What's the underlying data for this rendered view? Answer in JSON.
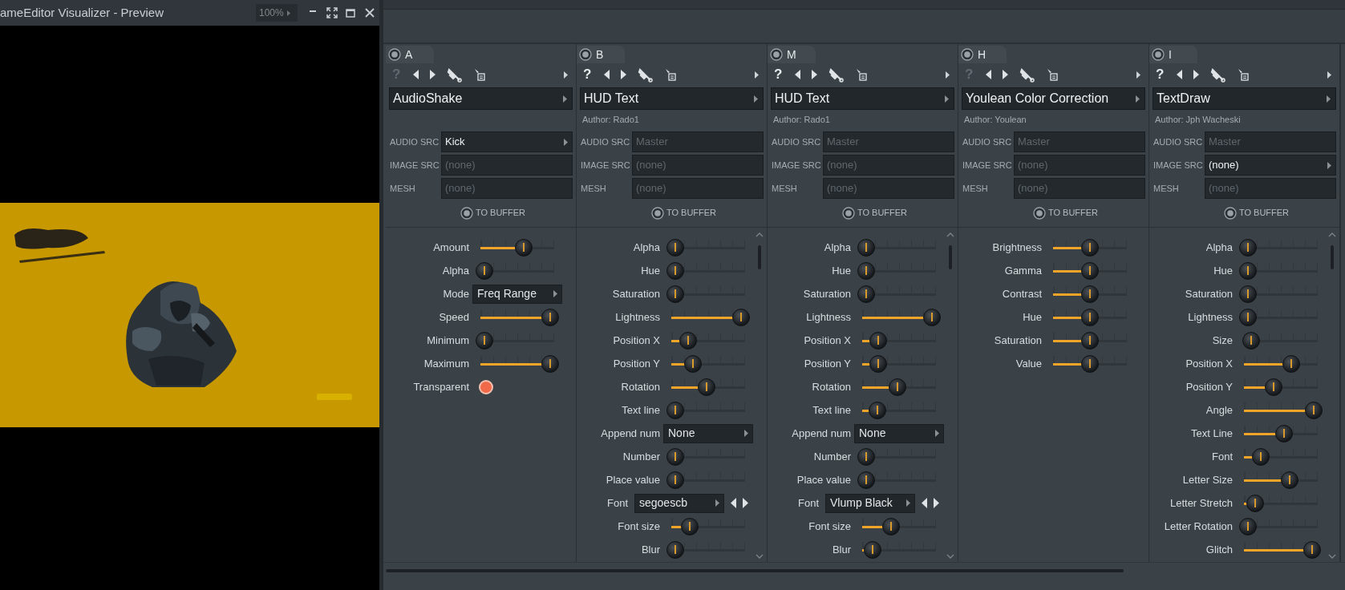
{
  "preview_window": {
    "title": "ameEditor Visualizer - Preview",
    "zoom": "100%"
  },
  "columns": [
    {
      "tab": "A",
      "help": "?",
      "help_enabled": false,
      "plugin": "AudioShake",
      "sources": [
        {
          "label": "AUDIO SRC",
          "value": "Kick",
          "enabled": true
        },
        {
          "label": "IMAGE SRC",
          "value": "(none)",
          "enabled": false
        },
        {
          "label": "MESH",
          "value": "(none)",
          "enabled": false
        }
      ],
      "buffer_label": "TO BUFFER",
      "params": [
        {
          "kind": "slider",
          "label": "Amount",
          "level": 0.6
        },
        {
          "kind": "slider",
          "label": "Alpha",
          "level": 0
        },
        {
          "kind": "choice",
          "label": "Mode",
          "value": "Freq Range"
        },
        {
          "kind": "slider",
          "label": "Speed",
          "level": 1
        },
        {
          "kind": "slider",
          "label": "Minimum",
          "level": 0
        },
        {
          "kind": "slider",
          "label": "Maximum",
          "level": 1
        },
        {
          "kind": "toggle",
          "label": "Transparent",
          "on": true
        }
      ]
    },
    {
      "tab": "B",
      "help": "?",
      "help_enabled": true,
      "plugin": "HUD Text",
      "author": "Author: Rado1",
      "sources": [
        {
          "label": "AUDIO SRC",
          "value": "Master",
          "enabled": false
        },
        {
          "label": "IMAGE SRC",
          "value": "(none)",
          "enabled": false
        },
        {
          "label": "MESH",
          "value": "(none)",
          "enabled": false
        }
      ],
      "buffer_label": "TO BUFFER",
      "params": [
        {
          "kind": "slider",
          "label": "Alpha",
          "level": 0
        },
        {
          "kind": "slider",
          "label": "Hue",
          "level": 0
        },
        {
          "kind": "slider",
          "label": "Saturation",
          "level": 0
        },
        {
          "kind": "slider",
          "label": "Lightness",
          "level": 1
        },
        {
          "kind": "slider",
          "label": "Position X",
          "level": 0.2
        },
        {
          "kind": "slider",
          "label": "Position Y",
          "level": 0.27
        },
        {
          "kind": "slider",
          "label": "Rotation",
          "level": 0.47
        },
        {
          "kind": "slider",
          "label": "Text line",
          "level": 0
        },
        {
          "kind": "choice",
          "label": "Append num",
          "value": "None"
        },
        {
          "kind": "slider",
          "label": "Number",
          "level": 0
        },
        {
          "kind": "slider",
          "label": "Place value",
          "level": 0
        },
        {
          "kind": "font",
          "label": "Font",
          "value": "segoescb"
        },
        {
          "kind": "slider",
          "label": "Font size",
          "level": 0.22
        },
        {
          "kind": "slider",
          "label": "Blur",
          "level": 0
        }
      ]
    },
    {
      "tab": "M",
      "help": "?",
      "help_enabled": true,
      "plugin": "HUD Text",
      "author": "Author: Rado1",
      "sources": [
        {
          "label": "AUDIO SRC",
          "value": "Master",
          "enabled": false
        },
        {
          "label": "IMAGE SRC",
          "value": "(none)",
          "enabled": false
        },
        {
          "label": "MESH",
          "value": "(none)",
          "enabled": false
        }
      ],
      "buffer_label": "TO BUFFER",
      "params": [
        {
          "kind": "slider",
          "label": "Alpha",
          "level": 0
        },
        {
          "kind": "slider",
          "label": "Hue",
          "level": 0
        },
        {
          "kind": "slider",
          "label": "Saturation",
          "level": 0
        },
        {
          "kind": "slider",
          "label": "Lightness",
          "level": 1
        },
        {
          "kind": "slider",
          "label": "Position X",
          "level": 0.18
        },
        {
          "kind": "slider",
          "label": "Position Y",
          "level": 0.18
        },
        {
          "kind": "slider",
          "label": "Rotation",
          "level": 0.47
        },
        {
          "kind": "slider",
          "label": "Text line",
          "level": 0.17
        },
        {
          "kind": "choice",
          "label": "Append num",
          "value": "None"
        },
        {
          "kind": "slider",
          "label": "Number",
          "level": 0
        },
        {
          "kind": "slider",
          "label": "Place value",
          "level": 0
        },
        {
          "kind": "font",
          "label": "Font",
          "value": "Vlump Black"
        },
        {
          "kind": "slider",
          "label": "Font size",
          "level": 0.38
        },
        {
          "kind": "slider",
          "label": "Blur",
          "level": 0.1
        }
      ]
    },
    {
      "tab": "H",
      "help": "?",
      "help_enabled": false,
      "plugin": "Youlean Color Correction",
      "author": "Author: Youlean",
      "sources": [
        {
          "label": "AUDIO SRC",
          "value": "Master",
          "enabled": false
        },
        {
          "label": "IMAGE SRC",
          "value": "(none)",
          "enabled": false
        },
        {
          "label": "MESH",
          "value": "(none)",
          "enabled": false
        }
      ],
      "buffer_label": "TO BUFFER",
      "params": [
        {
          "kind": "slider",
          "label": "Brightness",
          "level": 0.5
        },
        {
          "kind": "slider",
          "label": "Gamma",
          "level": 0.5
        },
        {
          "kind": "slider",
          "label": "Contrast",
          "level": 0.5
        },
        {
          "kind": "slider",
          "label": "Hue",
          "level": 0.5
        },
        {
          "kind": "slider",
          "label": "Saturation",
          "level": 0.5
        },
        {
          "kind": "slider",
          "label": "Value",
          "level": 0.5
        }
      ]
    },
    {
      "tab": "I",
      "help": "?",
      "help_enabled": true,
      "plugin": "TextDraw",
      "author": "Author: Jph Wacheski",
      "sources": [
        {
          "label": "AUDIO SRC",
          "value": "Master",
          "enabled": false
        },
        {
          "label": "IMAGE SRC",
          "value": "(none)",
          "enabled": true
        },
        {
          "label": "MESH",
          "value": "(none)",
          "enabled": false
        }
      ],
      "buffer_label": "TO BUFFER",
      "params": [
        {
          "kind": "slider",
          "label": "Alpha",
          "level": 0
        },
        {
          "kind": "slider",
          "label": "Hue",
          "level": 0
        },
        {
          "kind": "slider",
          "label": "Saturation",
          "level": 0
        },
        {
          "kind": "slider",
          "label": "Lightness",
          "level": 0
        },
        {
          "kind": "slider",
          "label": "Size",
          "level": 0.05
        },
        {
          "kind": "slider",
          "label": "Position X",
          "level": 0.66
        },
        {
          "kind": "slider",
          "label": "Position Y",
          "level": 0.39
        },
        {
          "kind": "slider",
          "label": "Angle",
          "level": 1
        },
        {
          "kind": "slider",
          "label": "Text Line",
          "level": 0.55
        },
        {
          "kind": "slider",
          "label": "Font",
          "level": 0.19
        },
        {
          "kind": "slider",
          "label": "Letter Size",
          "level": 0.63
        },
        {
          "kind": "slider",
          "label": "Letter Stretch",
          "level": 0.11
        },
        {
          "kind": "slider",
          "label": "Letter Rotation",
          "level": 0
        },
        {
          "kind": "slider",
          "label": "Glitch",
          "level": 0.97
        }
      ]
    }
  ]
}
